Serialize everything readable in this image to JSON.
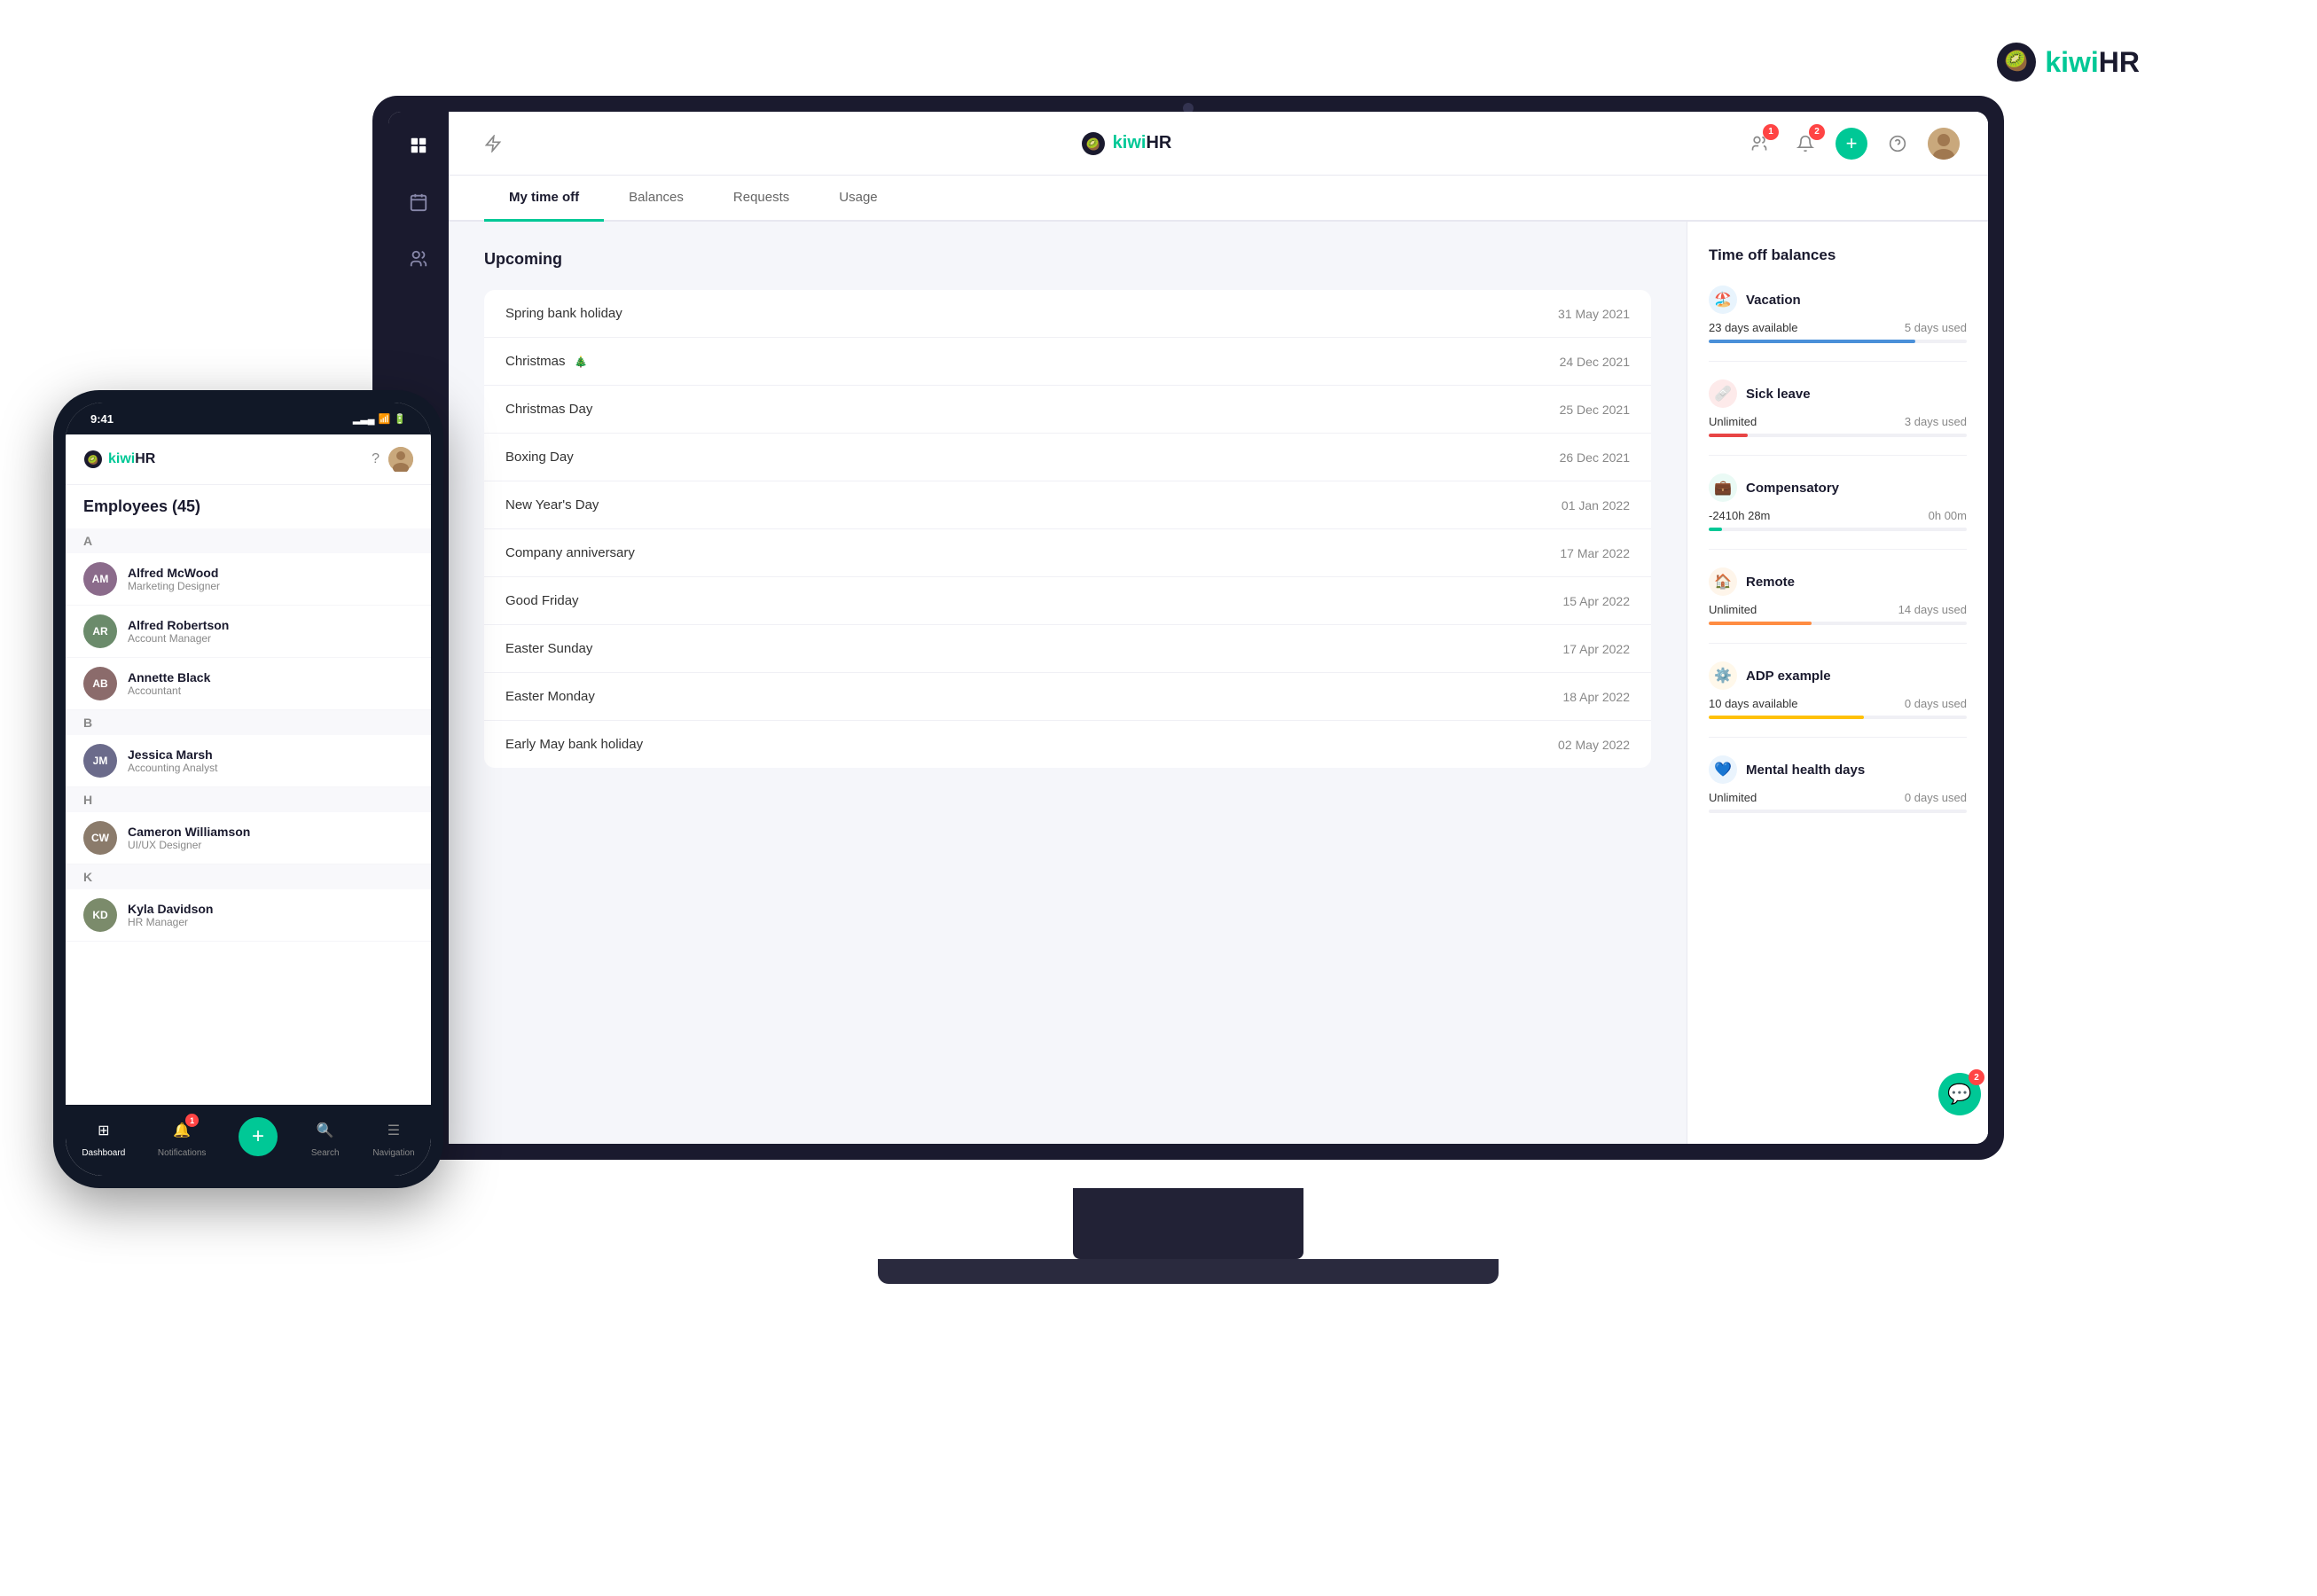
{
  "topLogo": {
    "text_kiwi": "kiwi",
    "text_hr": "HR"
  },
  "laptop": {
    "header": {
      "logo_kiwi": "kiwi",
      "logo_hr": "HR",
      "icons": [
        "team",
        "bell",
        "add",
        "help",
        "avatar"
      ],
      "bell1_badge": "1",
      "bell2_badge": "2"
    },
    "nav": {
      "tabs": [
        "My time off",
        "Balances",
        "Requests",
        "Usage"
      ],
      "active": "My time off"
    },
    "main": {
      "section_title": "Upcoming",
      "events": [
        {
          "name": "Spring bank holiday",
          "date": "31 May 2021"
        },
        {
          "name": "Christmas",
          "date": "24 Dec 2021",
          "icon": true
        },
        {
          "name": "Christmas Day",
          "date": "25 Dec 2021"
        },
        {
          "name": "Boxing Day",
          "date": "26 Dec 2021"
        },
        {
          "name": "New Year's Day",
          "date": "01 Jan 2022"
        },
        {
          "name": "Company anniversary",
          "date": "17 Mar 2022"
        },
        {
          "name": "Good Friday",
          "date": "15 Apr 2022"
        },
        {
          "name": "Easter Sunday",
          "date": "17 Apr 2022"
        },
        {
          "name": "Easter Monday",
          "date": "18 Apr 2022"
        },
        {
          "name": "Early May bank holiday",
          "date": "02 May 2022"
        }
      ]
    },
    "rightPanel": {
      "title": "Time off balances",
      "balances": [
        {
          "name": "Vacation",
          "icon": "🏖️",
          "icon_bg": "#e8f4fd",
          "available": "23 days available",
          "used": "5 days used",
          "bar_color": "#4a90d9",
          "bar_pct": 80
        },
        {
          "name": "Sick leave",
          "icon": "🩹",
          "icon_bg": "#fdeaea",
          "available": "Unlimited",
          "used": "3 days used",
          "bar_color": "#e84545",
          "bar_pct": 15
        },
        {
          "name": "Compensatory",
          "icon": "💼",
          "icon_bg": "#eafaf5",
          "available": "-2410h 28m",
          "used": "0h 00m",
          "bar_color": "#00c896",
          "bar_pct": 5
        },
        {
          "name": "Remote",
          "icon": "🏠",
          "icon_bg": "#fef5ea",
          "available": "Unlimited",
          "used": "14 days used",
          "bar_color": "#ff8c42",
          "bar_pct": 40
        },
        {
          "name": "ADP example",
          "icon": "⚙️",
          "icon_bg": "#fff8ea",
          "available": "10 days available",
          "used": "0 days used",
          "bar_color": "#ffc107",
          "bar_pct": 60
        },
        {
          "name": "Mental health days",
          "icon": "💙",
          "icon_bg": "#eaf4fd",
          "available": "Unlimited",
          "used": "0 days used",
          "bar_color": "#4a90d9",
          "bar_pct": 0
        }
      ]
    }
  },
  "phone": {
    "time": "9:41",
    "logo_kiwi": "kiwi",
    "logo_hr": "HR",
    "employees_title": "Employees (45)",
    "sections": [
      {
        "letter": "A",
        "employees": [
          {
            "name": "Alfred McWood",
            "role": "Marketing Designer",
            "avatar_color": "#8B6B8B"
          },
          {
            "name": "Alfred Robertson",
            "role": "Account Manager",
            "avatar_color": "#6B8B6B"
          },
          {
            "name": "Annette Black",
            "role": "Accountant",
            "avatar_color": "#8B6B6B"
          }
        ]
      },
      {
        "letter": "B",
        "employees": [
          {
            "name": "Jessica Marsh",
            "role": "Accounting Analyst",
            "avatar_color": "#6B6B8B"
          }
        ]
      },
      {
        "letter": "H",
        "employees": [
          {
            "name": "Cameron Williamson",
            "role": "UI/UX Designer",
            "avatar_color": "#8B7B6B"
          }
        ]
      },
      {
        "letter": "K",
        "employees": [
          {
            "name": "Kyla Davidson",
            "role": "HR Manager",
            "avatar_color": "#7B8B6B"
          }
        ]
      }
    ],
    "bottomNav": [
      {
        "label": "Dashboard",
        "icon": "⊞",
        "active": true
      },
      {
        "label": "Notifications",
        "icon": "🔔",
        "badge": "1",
        "active": false
      },
      {
        "label": "+",
        "type": "add"
      },
      {
        "label": "Search",
        "icon": "🔍",
        "active": false
      },
      {
        "label": "Navigation",
        "icon": "☰",
        "active": false
      }
    ]
  }
}
